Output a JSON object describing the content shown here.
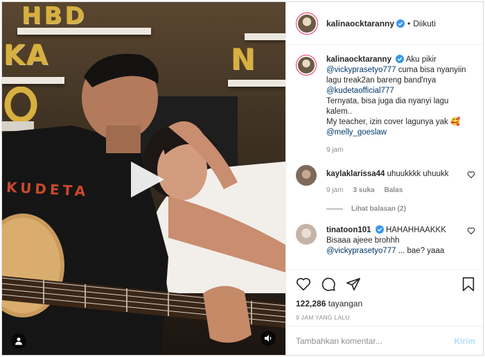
{
  "colors": {
    "accent": "#0095f6",
    "mention": "#00376b",
    "muted": "#8e8e8e",
    "verified": "#3897f0",
    "post_disabled": "#b2dffc"
  },
  "media": {
    "balloons": [
      "HBD",
      "KA",
      "N"
    ],
    "shirt_text": "KUDETA"
  },
  "header": {
    "username": "kalinaocktaranny",
    "separator": "•",
    "follow_label": "Diikuti"
  },
  "caption": {
    "username": "kalinaocktaranny",
    "text_1": "Aku pikir",
    "mention_1": "@vickyprasetyo777",
    "text_2": "cuma bisa nyanyiin lagu treak2an bareng band'nya",
    "mention_2": "@kudetaofficial777",
    "text_3": "Ternyata, bisa juga dia nyanyi lagu kalem..",
    "text_4": "My teacher, izin cover lagunya yak 🥰",
    "mention_3": "@melly_goeslaw",
    "time": "9 jam"
  },
  "comments": [
    {
      "username": "kaylaklarissa44",
      "text": "uhuukkkk uhuukk",
      "time": "9 jam",
      "likes": "3 suka",
      "reply_label": "Balas",
      "view_replies": "Lihat balasan (2)"
    },
    {
      "username": "tinatoon101",
      "text_1": "HAHAHHAAKKK",
      "text_2": "Bisaaa ajeee brohhh",
      "mention": "@vickyprasetyo777",
      "text_3": "... bae? yaaa"
    }
  ],
  "actions": {
    "views_count": "122,286",
    "views_label": "tayangan",
    "timestamp": "9 JAM YANG LALU"
  },
  "comment_box": {
    "placeholder": "Tambahkan komentar...",
    "post_label": "Kirim"
  }
}
